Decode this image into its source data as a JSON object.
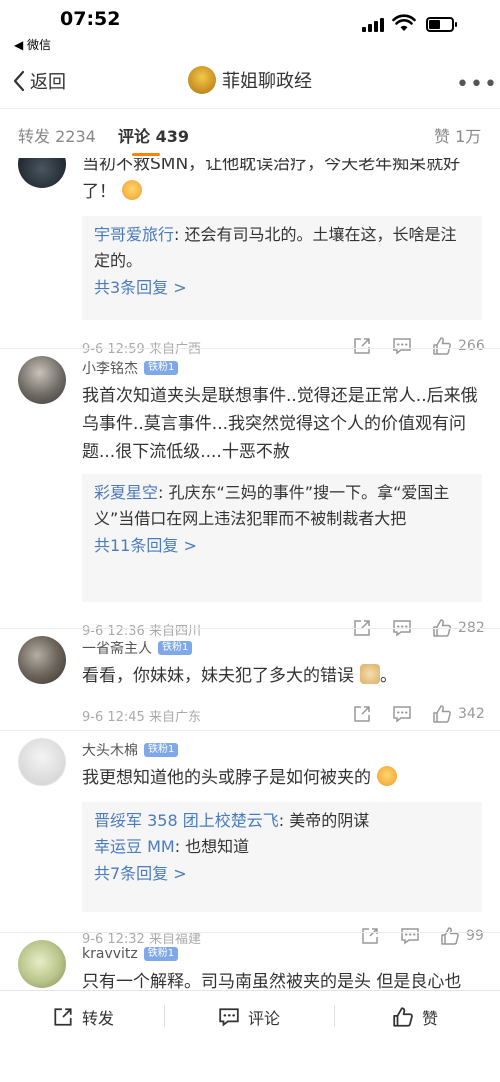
{
  "status": {
    "time": "07:52",
    "back_app": "◀ 微信"
  },
  "nav": {
    "back_label": "返回",
    "title": "菲姐聊政经",
    "more": "•••"
  },
  "tabs": {
    "repost": "转发 2234",
    "comment": "评论 439",
    "like": "赞 1万"
  },
  "comments": [
    {
      "text": "当初不救SMN，让他耽误治疗，今天老年痴呆就好了！",
      "replies": [
        {
          "name": "宇哥爱旅行",
          "text": ": 还会有司马北的。土壤在这，长啥是注定的。"
        }
      ],
      "more": "共3条回复 >",
      "time": "9-6 12:59 来自广西",
      "likes": "266"
    },
    {
      "name": "小李铭杰",
      "badge": "铁粉1",
      "text": "我首次知道夹头是联想事件..觉得还是正常人..后来俄乌事件..莫言事件...我突然觉得这个人的价值观有问题...很下流低级....十恶不赦",
      "replies": [
        {
          "name": "彩夏星空",
          "text": ": 孔庆东“三妈的事件”搜一下。拿“爱国主义”当借口在网上违法犯罪而不被制裁者大把"
        }
      ],
      "more": "共11条回复 >",
      "time": "9-6 12:36 来自四川",
      "likes": "282"
    },
    {
      "name": "一省斋主人",
      "badge": "铁粉1",
      "text": "看看，你妹妹，妹夫犯了多大的错误",
      "text_end": "。",
      "time": "9-6 12:45 来自广东",
      "likes": "342"
    },
    {
      "name": "大头木棉",
      "badge": "铁粉1",
      "text": "我更想知道他的头或脖子是如何被夹的",
      "replies": [
        {
          "name": "晋绥军 358 团上校楚云飞",
          "text": ": 美帝的阴谋"
        },
        {
          "name": "幸运豆 MM",
          "text": ": 也想知道"
        }
      ],
      "more": "共7条回复 >",
      "time": "9-6 12:32 来自福建",
      "likes": "99"
    },
    {
      "name": "kravvitz",
      "badge": "铁粉1",
      "text": "只有一个解释。司马南虽然被夹的是头 但是良心也"
    }
  ],
  "bottom": {
    "repost": "转发",
    "comment": "评论",
    "like": "赞"
  },
  "colors": {
    "accent": "#ff8200",
    "link": "#4a7bbf",
    "badge": "#7fa8e8"
  }
}
